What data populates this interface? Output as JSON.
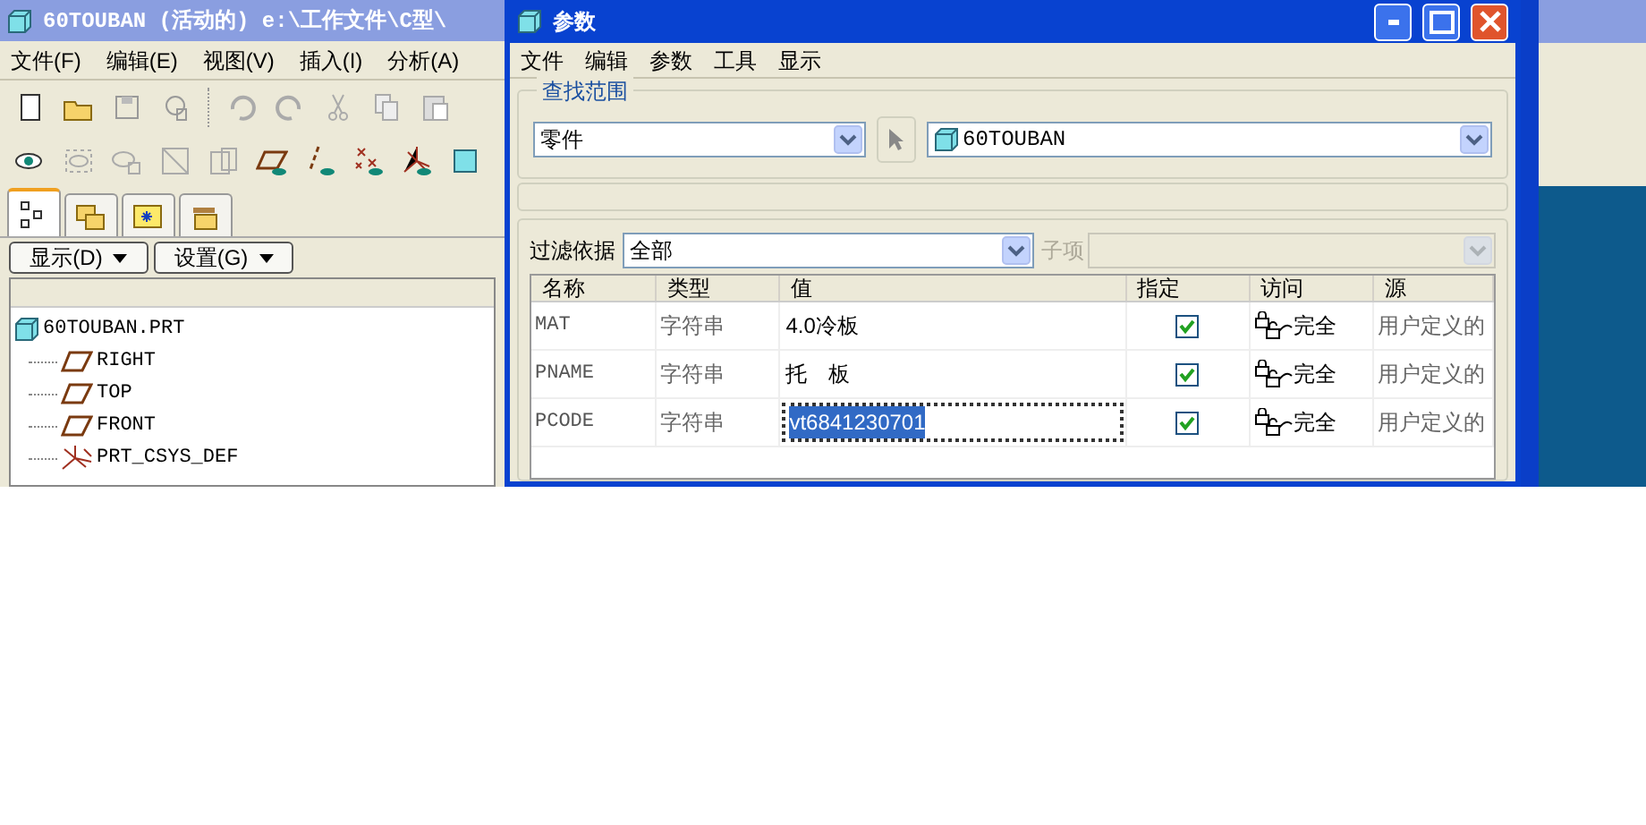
{
  "main_window": {
    "title": "60TOUBAN (活动的) e:\\工作文件\\C型\\",
    "menu": [
      "文件(F)",
      "编辑(E)",
      "视图(V)",
      "插入(I)",
      "分析(A)"
    ],
    "tabs": [
      {
        "selected": true
      },
      {
        "selected": false
      },
      {
        "selected": false
      },
      {
        "selected": false
      }
    ],
    "buttons": [
      "显示(D)",
      "设置(G)"
    ],
    "tree": [
      {
        "label": "60TOUBAN.PRT",
        "kind": "part",
        "children": [
          {
            "label": "RIGHT",
            "kind": "plane"
          },
          {
            "label": "TOP",
            "kind": "plane"
          },
          {
            "label": "FRONT",
            "kind": "plane"
          },
          {
            "label": "PRT_CSYS_DEF",
            "kind": "csys"
          }
        ]
      }
    ]
  },
  "dialog": {
    "title": "参数",
    "menu": [
      "文件",
      "编辑",
      "参数",
      "工具",
      "显示"
    ],
    "scope": {
      "legend": "查找范围",
      "type": "零件",
      "object": "60TOUBAN"
    },
    "filter": {
      "label": "过滤依据",
      "value": "全部",
      "sub_label": "子项",
      "sub_disabled": true
    },
    "table": {
      "columns": [
        "名称",
        "类型",
        "值",
        "指定",
        "访问",
        "源"
      ],
      "rows": [
        {
          "name": "MAT",
          "type": "字符串",
          "value": "4.0冷板",
          "designated": true,
          "access": "完全",
          "source": "用户定义的",
          "selected": false
        },
        {
          "name": "PNAME",
          "type": "字符串",
          "value": "托　板",
          "designated": true,
          "access": "完全",
          "source": "用户定义的",
          "selected": false
        },
        {
          "name": "PCODE",
          "type": "字符串",
          "value": "vt6841230701",
          "designated": true,
          "access": "完全",
          "source": "用户定义的",
          "selected": true
        }
      ]
    }
  }
}
